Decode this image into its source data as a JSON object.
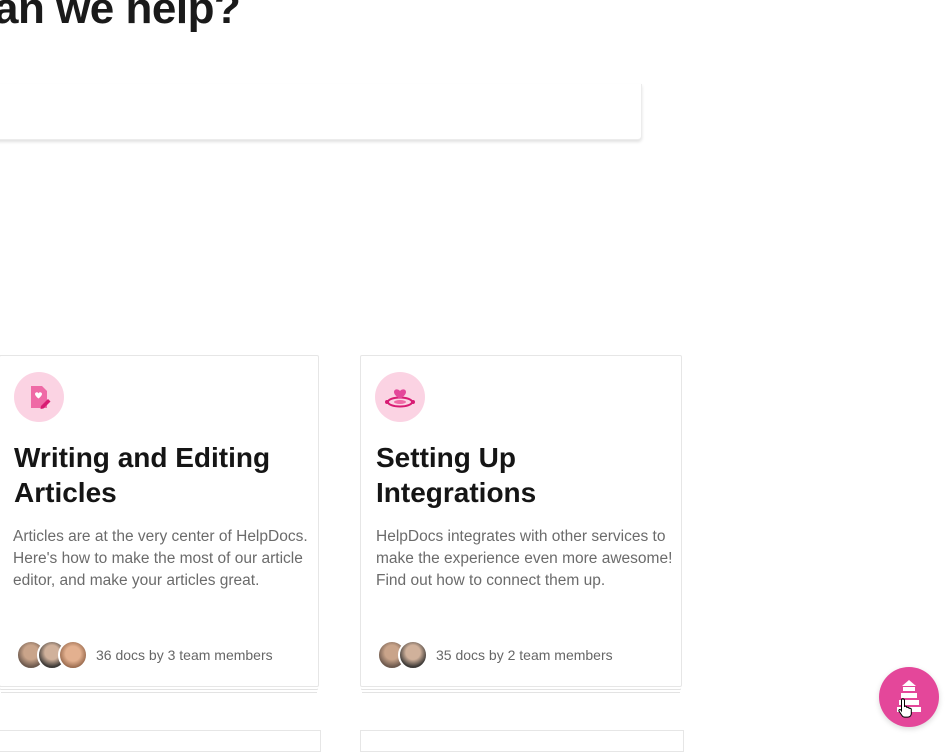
{
  "hero": {
    "title": "an we help?"
  },
  "search": {
    "placeholder": "",
    "value": ""
  },
  "categories": [
    {
      "icon": "edit-document-heart-icon",
      "title": "Writing and Editing Articles",
      "description": "Articles are at the very center of HelpDocs. Here's how to make the most of our article editor, and make your articles great.",
      "meta": "36 docs by 3 team members"
    },
    {
      "icon": "integrations-heart-icon",
      "title": "Setting Up Integrations",
      "description": "HelpDocs integrates with other services to make the experience even more awesome! Find out how to connect them up.",
      "meta": "35 docs by 2 team members"
    }
  ],
  "launcher": {
    "icon": "lighthouse-icon"
  },
  "colors": {
    "accent": "#e4479a",
    "icon_bg": "#fbd3e3"
  }
}
